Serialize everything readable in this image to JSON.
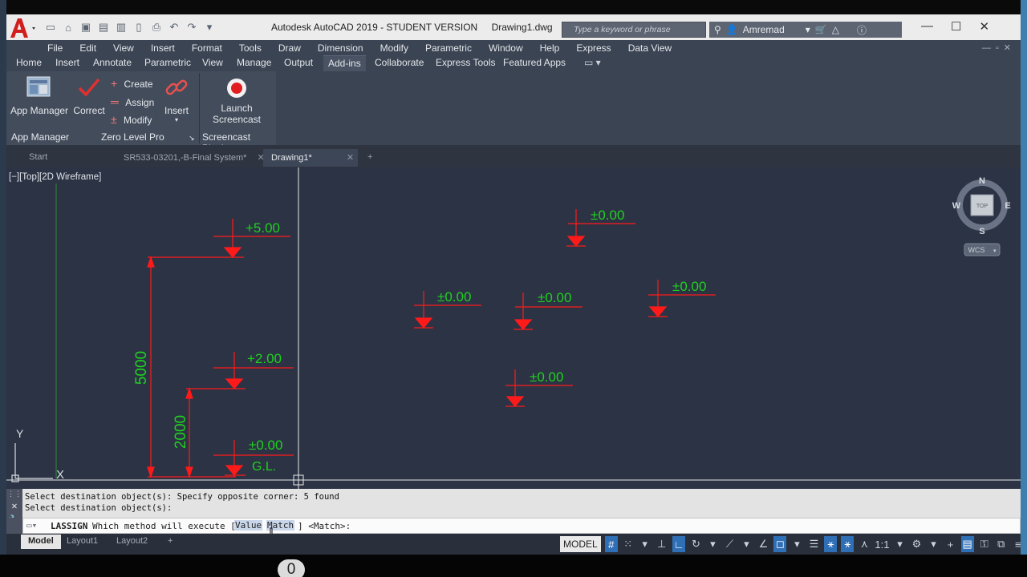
{
  "window": {
    "title": "Autodesk AutoCAD 2019 - STUDENT VERSION",
    "file": "Drawing1.dwg",
    "search_placeholder": "Type a keyword or phrase",
    "user": "Amremad"
  },
  "menu": [
    "File",
    "Edit",
    "View",
    "Insert",
    "Format",
    "Tools",
    "Draw",
    "Dimension",
    "Modify",
    "Parametric",
    "Window",
    "Help",
    "Express",
    "Data View"
  ],
  "ribbon_tabs": [
    "Home",
    "Insert",
    "Annotate",
    "Parametric",
    "View",
    "Manage",
    "Output",
    "Add-ins",
    "Collaborate",
    "Express Tools",
    "Featured Apps"
  ],
  "active_ribbon_tab": "Add-ins",
  "ribbon": {
    "app_manager_button": "App Manager",
    "correct_button": "Correct",
    "create_button": "Create",
    "assign_button": "Assign",
    "modify_button": "Modify",
    "insert_button": "Insert",
    "launch_line1": "Launch",
    "launch_line2": "Screencast",
    "panels": [
      "App Manager",
      "Zero Level Pro",
      "Screencast Plugin"
    ]
  },
  "file_tabs": [
    {
      "label": "Start"
    },
    {
      "label": "SR533-03201,-B-Final System*"
    },
    {
      "label": "Drawing1*"
    }
  ],
  "viewport_label": "[−][Top][2D Wireframe]",
  "viewcube": {
    "n": "N",
    "s": "S",
    "e": "E",
    "w": "W",
    "top": "TOP",
    "wcs": "WCS"
  },
  "drawing": {
    "levels": [
      "+5.00",
      "+2.00",
      "±0.00",
      "G.L.",
      "±0.00",
      "±0.00",
      "±0.00",
      "±0.00",
      "±0.00"
    ],
    "dimensions": [
      "5000",
      "2000"
    ],
    "ucs_x": "X",
    "ucs_y": "Y"
  },
  "command": {
    "history": [
      "Select destination object(s): Specify opposite corner: 5 found",
      "Select destination object(s):"
    ],
    "input_name": "LASSIGN",
    "input_prompt": "Which method will execute [",
    "option_value": "Value",
    "option_match": "Match",
    "input_tail": "] <Match>:"
  },
  "layout_tabs": [
    "Model",
    "Layout1",
    "Layout2"
  ],
  "status": {
    "model": "MODEL",
    "scale": "1:1"
  },
  "key_counter": "0",
  "colors": {
    "canvas": "#2c3344",
    "level_red": "#ff1a1a",
    "level_text": "#1fd11f",
    "accent": "#2f6fb5"
  }
}
